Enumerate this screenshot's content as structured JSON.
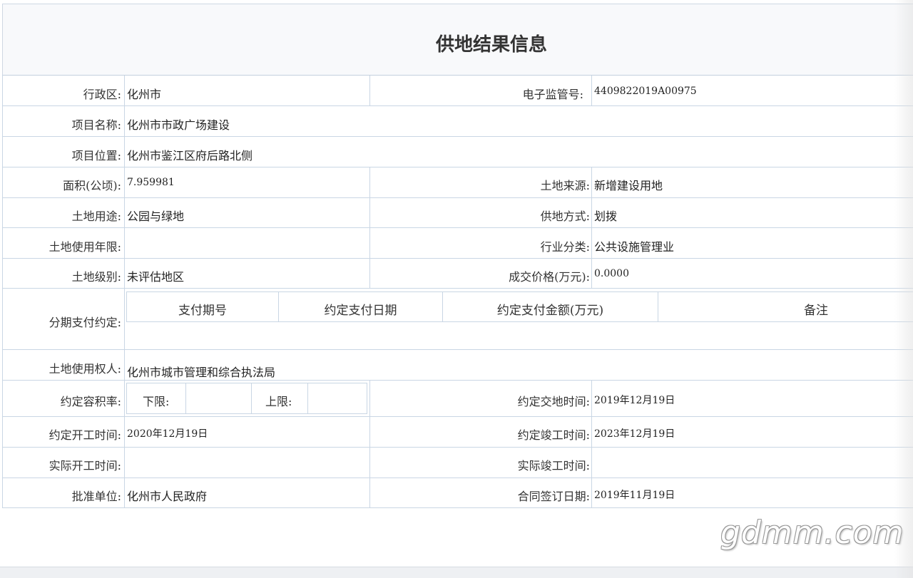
{
  "title": "供地结果信息",
  "rows": {
    "district_label": "行政区:",
    "district_value": "化州市",
    "supervision_no_label": "电子监管号:",
    "supervision_no_value": "4409822019A00975",
    "project_name_label": "项目名称:",
    "project_name_value": "化州市市政广场建设",
    "project_location_label": "项目位置:",
    "project_location_value": "化州市鉴江区府后路北侧",
    "area_label": "面积(公顷):",
    "area_value": "7.959981",
    "land_source_label": "土地来源:",
    "land_source_value": "新增建设用地",
    "land_use_label": "土地用途:",
    "land_use_value": "公园与绿地",
    "supply_method_label": "供地方式:",
    "supply_method_value": "划拨",
    "use_term_label": "土地使用年限:",
    "use_term_value": "",
    "industry_label": "行业分类:",
    "industry_value": "公共设施管理业",
    "land_grade_label": "土地级别:",
    "land_grade_value": "未评估地区",
    "price_label": "成交价格(万元):",
    "price_value": "0.0000",
    "installment_label": "分期支付约定:",
    "installment_headers": [
      "支付期号",
      "约定支付日期",
      "约定支付金额(万元)",
      "备注"
    ],
    "right_holder_label": "土地使用权人:",
    "right_holder_value": "化州市城市管理和综合执法局",
    "plot_ratio_label": "约定容积率:",
    "lower_limit_label": "下限:",
    "lower_limit_value": "",
    "upper_limit_label": "上限:",
    "upper_limit_value": "",
    "handover_label": "约定交地时间:",
    "handover_value": "2019年12月19日",
    "start_label": "约定开工时间:",
    "start_value": "2020年12月19日",
    "completion_label": "约定竣工时间:",
    "completion_value": "2023年12月19日",
    "actual_start_label": "实际开工时间:",
    "actual_start_value": "",
    "actual_completion_label": "实际竣工时间:",
    "actual_completion_value": "",
    "approver_label": "批准单位:",
    "approver_value": "化州市人民政府",
    "contract_date_label": "合同签订日期:",
    "contract_date_value": "2019年11月19日"
  },
  "watermark": "gdmm.com"
}
